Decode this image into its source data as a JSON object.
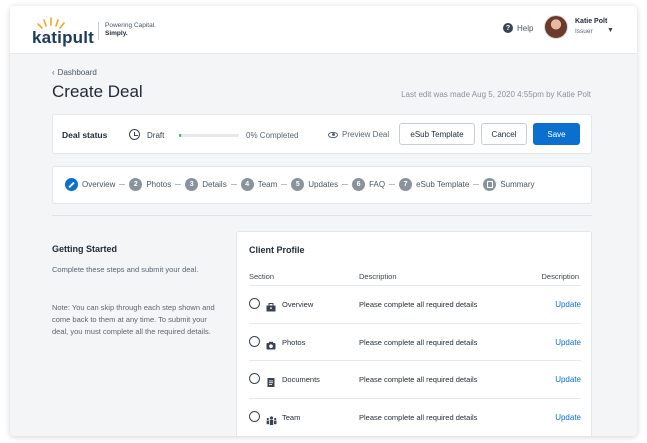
{
  "brand": {
    "logo": "katipult",
    "tagline_1": "Powering Capital.",
    "tagline_2": "Simply.",
    "accent": "#0b6fd0",
    "logo_color": "#1d3a63",
    "sun_color": "#f5a623"
  },
  "header": {
    "help_label": "Help",
    "user_name": "Katie Polt",
    "user_role": "Issuer"
  },
  "page": {
    "back_label": "Dashboard",
    "title": "Create Deal",
    "last_edit": "Last edit was made Aug 5, 2020 4:55pm by Katie Polt"
  },
  "status": {
    "label": "Deal status",
    "state": "Draft",
    "progress_percent": 0,
    "progress_text": "0% Completed",
    "preview_label": "Preview Deal",
    "esub_label": "eSub Template",
    "cancel_label": "Cancel",
    "save_label": "Save"
  },
  "steps": [
    {
      "num": "",
      "label": "Overview",
      "active": true,
      "icon": "pencil-icon"
    },
    {
      "num": "2",
      "label": "Photos",
      "active": false
    },
    {
      "num": "3",
      "label": "Details",
      "active": false
    },
    {
      "num": "4",
      "label": "Team",
      "active": false
    },
    {
      "num": "5",
      "label": "Updates",
      "active": false
    },
    {
      "num": "6",
      "label": "FAQ",
      "active": false
    },
    {
      "num": "7",
      "label": "eSub Template",
      "active": false
    },
    {
      "num": "",
      "label": "Summary",
      "active": false,
      "icon": "document-icon"
    }
  ],
  "getting_started": {
    "title": "Getting Started",
    "text": "Complete these steps and submit your deal.",
    "note": "Note: You can skip through each step shown and come back to them at any time. To submit your deal, you must complete all the required details."
  },
  "client_profile": {
    "title": "Client Profile",
    "col_section": "Section",
    "col_description": "Description",
    "col_action": "Description",
    "rows": [
      {
        "icon": "briefcase-icon",
        "section": "Overview",
        "description": "Please complete all required details",
        "action": "Update"
      },
      {
        "icon": "camera-icon",
        "section": "Photos",
        "description": "Please complete all required details",
        "action": "Update"
      },
      {
        "icon": "document-icon",
        "section": "Documents",
        "description": "Please complete all required details",
        "action": "Update"
      },
      {
        "icon": "team-icon",
        "section": "Team",
        "description": "Please complete all required details",
        "action": "Update"
      }
    ]
  }
}
